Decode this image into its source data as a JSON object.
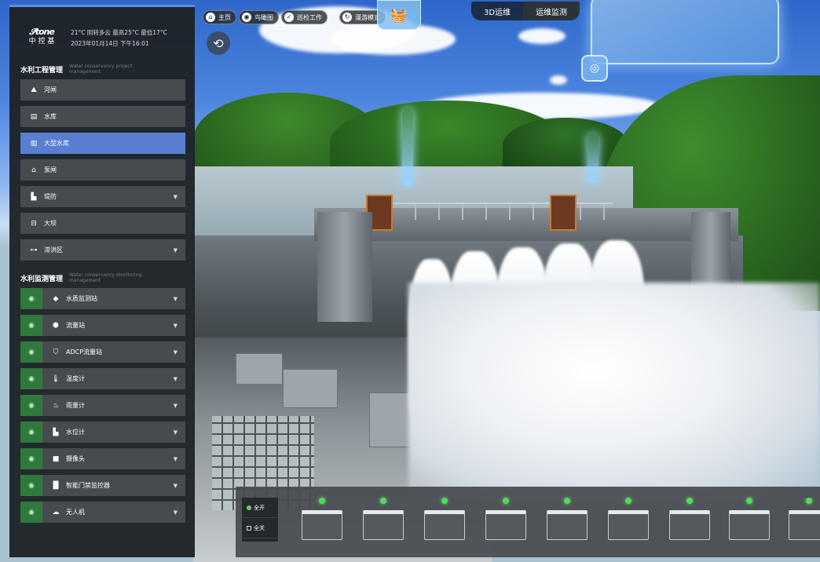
{
  "top_bar": {
    "chips": [
      {
        "icon": "home-icon",
        "label": "主页"
      },
      {
        "icon": "aerial-icon",
        "label": "鸟瞰图"
      },
      {
        "icon": "task-icon",
        "label": "巡检工作"
      },
      {
        "icon": "tour-icon",
        "label": "漫游模式"
      }
    ],
    "view_tabs": [
      {
        "label": "3D运维",
        "active": false
      },
      {
        "label": "运维监测",
        "active": true
      }
    ]
  },
  "brand": {
    "logo_mark": "𝓢tone",
    "logo_text": "中 控 基",
    "weather_line": "21°C 阴转多云 最高25°C 最低17°C",
    "datetime_line": "2023年01月14日 下午16:01"
  },
  "section_project": {
    "title": "水利工程管理",
    "subtitle": "Water conservancy project management",
    "items": [
      {
        "icon": "dam-icon",
        "label": "河闸",
        "active": false,
        "expandable": false
      },
      {
        "icon": "reservoir-icon",
        "label": "水库",
        "active": false,
        "expandable": false
      },
      {
        "icon": "large-reservoir-icon",
        "label": "大型水库",
        "active": true,
        "expandable": false
      },
      {
        "icon": "sluice-icon",
        "label": "泵闸",
        "active": false,
        "expandable": false
      },
      {
        "icon": "bridge-icon",
        "label": "堤防",
        "active": false,
        "expandable": true
      },
      {
        "icon": "dike-icon",
        "label": "大坝",
        "active": false,
        "expandable": false
      },
      {
        "icon": "flood-area-icon",
        "label": "滞洪区",
        "active": false,
        "expandable": true
      }
    ]
  },
  "section_monitor": {
    "title": "水利监测管理",
    "subtitle": "Water conservancy monitoring management",
    "items": [
      {
        "icon": "water-level-icon",
        "label": "水质监测站",
        "expandable": true
      },
      {
        "icon": "gauge-station-icon",
        "label": "流量站",
        "expandable": true
      },
      {
        "icon": "shield-icon",
        "label": "ADCP流量站",
        "expandable": true
      },
      {
        "icon": "thermometer-icon",
        "label": "温度计",
        "expandable": true
      },
      {
        "icon": "rain-gauge-icon",
        "label": "雨量计",
        "expandable": true
      },
      {
        "icon": "level-meter-icon",
        "label": "水位计",
        "expandable": true
      },
      {
        "icon": "camera-icon",
        "label": "摄像头",
        "expandable": true
      },
      {
        "icon": "gate-sensor-icon",
        "label": "智能门禁监控器",
        "expandable": true
      },
      {
        "icon": "drone-icon",
        "label": "无人机",
        "expandable": true
      }
    ]
  },
  "camera_strip": {
    "controls": [
      {
        "label": "全开",
        "state": "on"
      },
      {
        "label": "全关",
        "state": "off"
      }
    ],
    "camera_count": 9
  },
  "colors": {
    "sidebar_bg": "#1e2226",
    "active_item": "#5b7fd0",
    "monitor_eye": "#2f7a3a",
    "status_led": "#58d65f"
  }
}
